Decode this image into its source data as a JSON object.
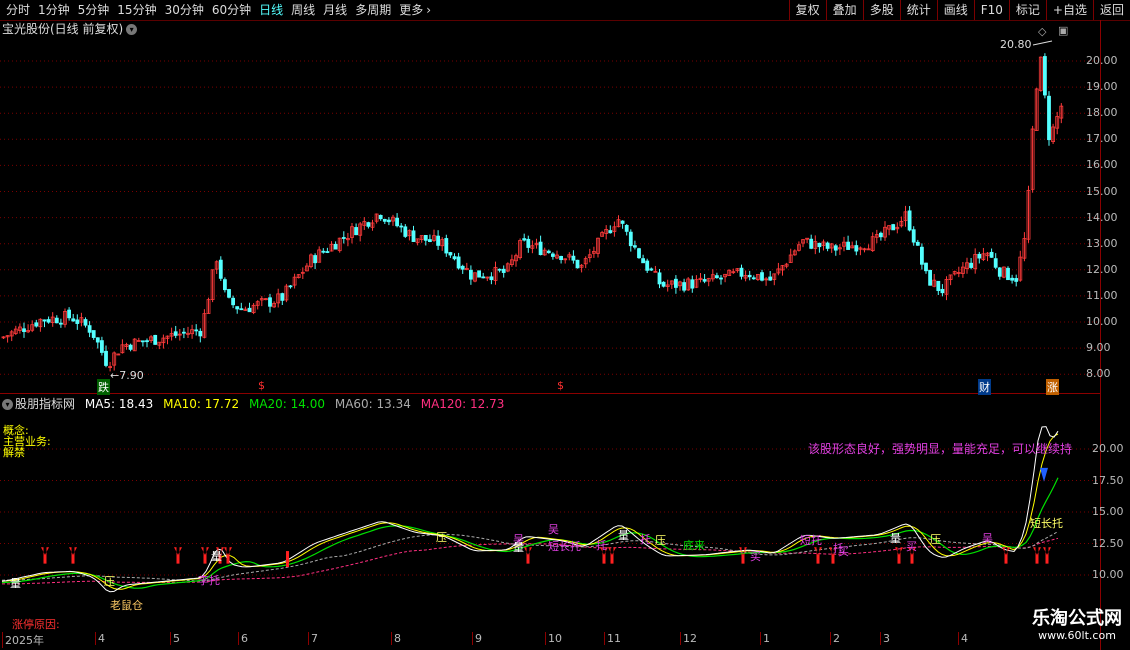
{
  "toolbar": {
    "periods": [
      "分时",
      "1分钟",
      "5分钟",
      "15分钟",
      "30分钟",
      "60分钟",
      "日线",
      "周线",
      "月线",
      "多周期",
      "更多"
    ],
    "active_period": "日线",
    "more_icon": "chevron-right-icon",
    "actions": [
      "复权",
      "叠加",
      "多股",
      "统计",
      "画线",
      "F10",
      "标记",
      "+自选",
      "返回"
    ]
  },
  "chart_title": "宝光股份(日线 前复权)",
  "main_chart": {
    "high_label": "20.80",
    "low_label": "7.90",
    "price_ticks": [
      "20.00",
      "19.00",
      "18.00",
      "17.00",
      "16.00",
      "15.00",
      "14.00",
      "13.00",
      "12.00",
      "11.00",
      "10.00",
      "9.00",
      "8.00"
    ],
    "markers": [
      "跌",
      "$",
      "$",
      "财",
      "涨"
    ]
  },
  "indicator": {
    "name": "股朋指标网",
    "ma5_label": "MA5: 18.43",
    "ma10_label": "MA10: 17.72",
    "ma20_label": "MA20: 14.00",
    "ma60_label": "MA60: 13.34",
    "ma120_label": "MA120: 12.73",
    "ticks": [
      "20.00",
      "17.50",
      "15.00",
      "12.50",
      "10.00"
    ],
    "notes": [
      "概念:",
      "主营业务:",
      "解禁"
    ],
    "message": "该股形态良好，强势明显，量能充足，可以继续持",
    "bottom_note": "涨停原因:",
    "signals": [
      "量",
      "老鼠仓",
      "压",
      "压",
      "量",
      "吴",
      "量",
      "短长托",
      "吴",
      "量",
      "托",
      "压",
      "底来",
      "买",
      "短托",
      "托",
      "量",
      "压",
      "买",
      "托",
      "买",
      "吴",
      "短长托",
      "李托"
    ]
  },
  "months": [
    "2025年",
    "4",
    "5",
    "6",
    "7",
    "8",
    "9",
    "10",
    "11",
    "12",
    "1",
    "2",
    "3",
    "4"
  ],
  "watermark": {
    "title": "乐淘公式网",
    "url": "www.60lt.com"
  },
  "colors": {
    "up": "#ff3b3b",
    "down": "#54ffff",
    "ma5": "#ffffff",
    "ma10": "#ffff00",
    "ma20": "#00e000",
    "ma60": "#aaaaaa",
    "ma120": "#ff2f80",
    "grid": "#7a0000"
  }
}
